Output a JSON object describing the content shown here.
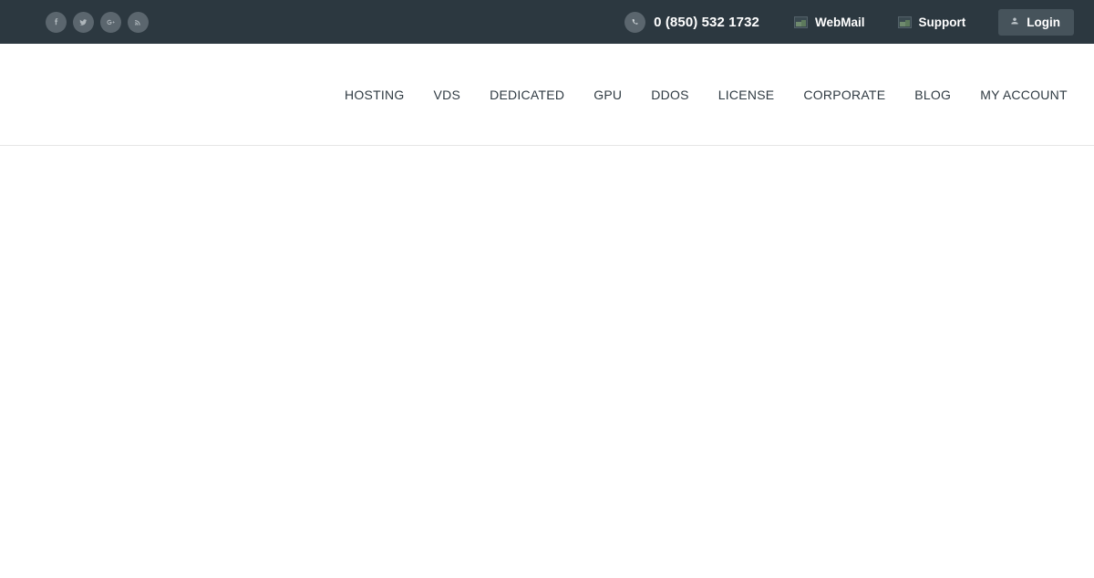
{
  "topbar": {
    "background_color": "#2c3840",
    "social_links": [
      {
        "name": "facebook",
        "icon": "facebook-icon",
        "label": "Facebook"
      },
      {
        "name": "twitter",
        "icon": "twitter-icon",
        "label": "Twitter"
      },
      {
        "name": "google-plus",
        "icon": "google-plus-icon",
        "label": "Google Plus"
      },
      {
        "name": "rss",
        "icon": "rss-icon",
        "label": "RSS"
      }
    ],
    "phone": {
      "icon": "phone-icon",
      "number": "0 (850) 532 1732"
    },
    "links": [
      {
        "icon": "broken-image-icon",
        "label": "WebMail"
      },
      {
        "icon": "broken-image-icon",
        "label": "Support"
      }
    ],
    "login": {
      "icon": "user-icon",
      "label": "Login",
      "background_color": "#46535b"
    }
  },
  "header": {
    "logo": {
      "alt": "",
      "visible": false
    },
    "border_color": "#e6e6e6",
    "nav": [
      {
        "label": "HOSTING"
      },
      {
        "label": "VDS"
      },
      {
        "label": "DEDICATED"
      },
      {
        "label": "GPU"
      },
      {
        "label": "DDOS"
      },
      {
        "label": "LICENSE"
      },
      {
        "label": "CORPORATE"
      },
      {
        "label": "BLOG"
      },
      {
        "label": "MY ACCOUNT"
      }
    ],
    "nav_text_color": "#2f3a42"
  },
  "body": {
    "content": "",
    "background_color": "#ffffff"
  }
}
